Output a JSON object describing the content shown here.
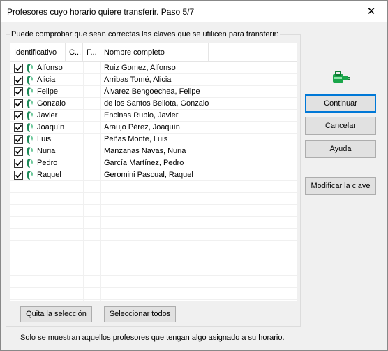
{
  "window": {
    "title": "Profesores cuyo horario quiere transferir. Paso 5/7",
    "close_glyph": "✕"
  },
  "group": {
    "label": "Puede comprobar que sean correctas las claves que se utilicen para transferir:"
  },
  "table": {
    "columns": [
      "Identificativo",
      "C...",
      "F...",
      "Nombre completo"
    ],
    "rows": [
      {
        "id": "Alfonso",
        "name": "Ruiz Gomez, Alfonso",
        "checked": true
      },
      {
        "id": "Alicia",
        "name": "Arribas Tomé, Alicia",
        "checked": true
      },
      {
        "id": "Felipe",
        "name": "Álvarez Bengoechea, Felipe",
        "checked": true
      },
      {
        "id": "Gonzalo",
        "name": "de los Santos Bellota, Gonzalo",
        "checked": true
      },
      {
        "id": "Javier",
        "name": "Encinas Rubio, Javier",
        "checked": true
      },
      {
        "id": "Joaquín",
        "name": "Araujo Pérez, Joaquín",
        "checked": true
      },
      {
        "id": "Luis",
        "name": "Peñas Monte, Luis",
        "checked": true
      },
      {
        "id": "Nuria",
        "name": "Manzanas Navas, Nuria",
        "checked": true
      },
      {
        "id": "Pedro",
        "name": "García Martínez, Pedro",
        "checked": true
      },
      {
        "id": "Raquel",
        "name": "Geromini Pascual, Raquel",
        "checked": true
      }
    ]
  },
  "buttons": {
    "continuar": "Continuar",
    "cancelar": "Cancelar",
    "ayuda": "Ayuda",
    "modificar": "Modificar la clave",
    "quita": "Quita la selección",
    "seleccionar": "Seleccionar todos"
  },
  "note": "Solo se muestran aquellos profesores que tengan algo asignado a su horario.",
  "icons": {
    "plug": "plug-icon",
    "user": "user-icon",
    "checkbox": "checkbox-checked"
  },
  "colors": {
    "accent": "#0078d7",
    "user_icon": "#1e8a5a",
    "plug_icon": "#1aa64a"
  }
}
